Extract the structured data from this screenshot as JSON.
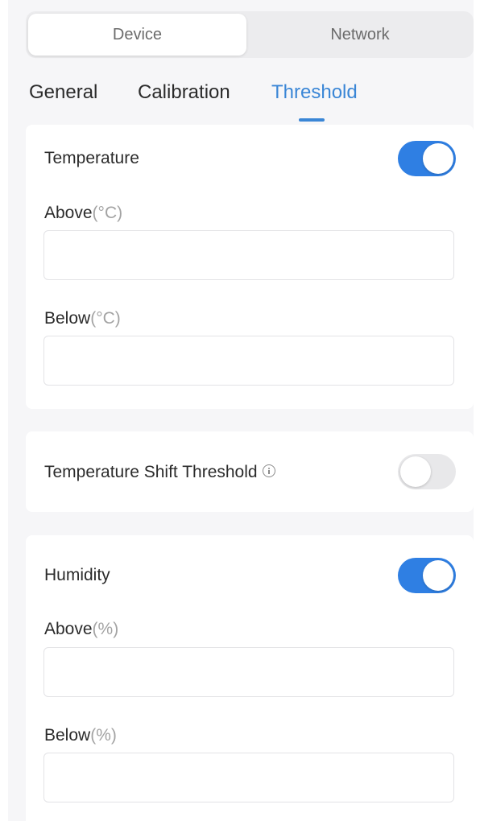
{
  "segmented": {
    "device_label": "Device",
    "network_label": "Network"
  },
  "tabs": [
    {
      "label": "General"
    },
    {
      "label": "Calibration"
    },
    {
      "label": "Threshold",
      "active": true
    }
  ],
  "temperature": {
    "title": "Temperature",
    "toggle_on": true,
    "above": {
      "label": "Above",
      "unit": "(°C)",
      "value": "",
      "placeholder": ""
    },
    "below": {
      "label": "Below",
      "unit": "(°C)",
      "value": "",
      "placeholder": ""
    }
  },
  "temperature_shift": {
    "title": "Temperature Shift Threshold",
    "toggle_on": false,
    "icon": "info-icon"
  },
  "humidity": {
    "title": "Humidity",
    "toggle_on": true,
    "above": {
      "label": "Above",
      "unit": "(%)",
      "value": "",
      "placeholder": ""
    },
    "below": {
      "label": "Below",
      "unit": "(%)",
      "value": "",
      "placeholder": ""
    }
  },
  "colors": {
    "accent": "#2f7fe3",
    "tab_active": "#3a86d6",
    "background": "#f6f6f8"
  }
}
